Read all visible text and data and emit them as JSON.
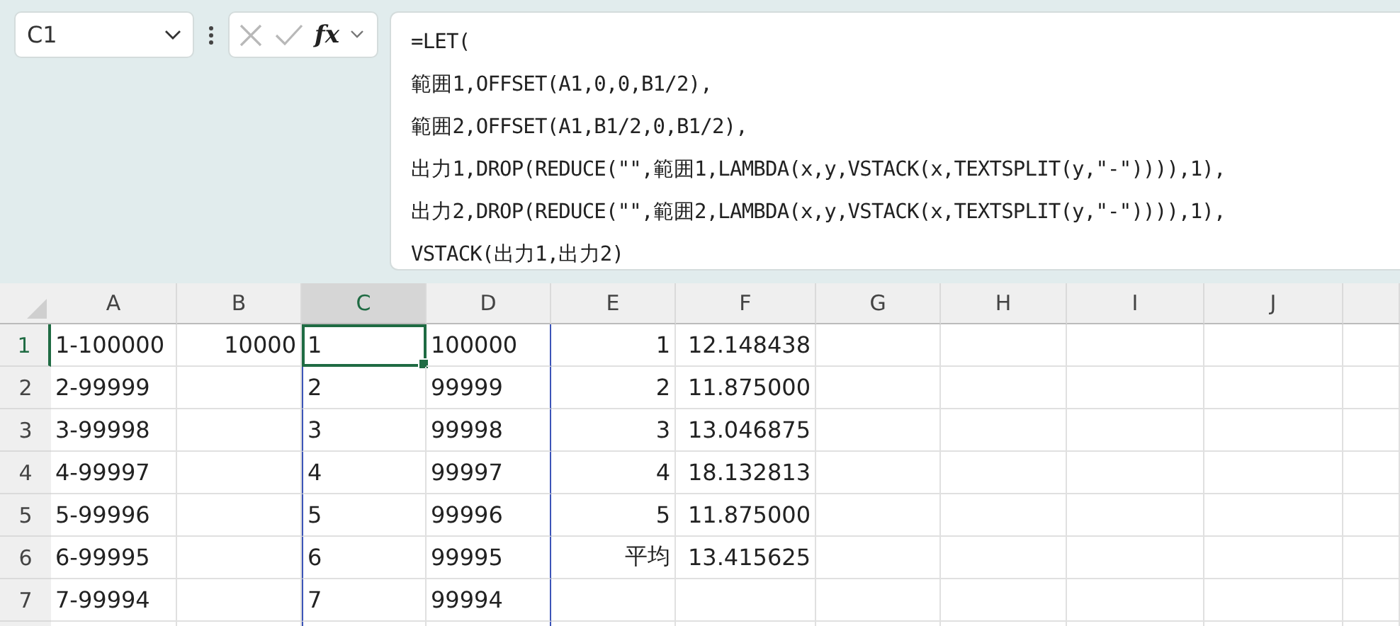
{
  "name_box": {
    "value": "C1"
  },
  "formula_buttons": {
    "disabled": true,
    "function_label": "fx"
  },
  "formula_bar": {
    "lines": [
      "=LET(",
      "範囲1,OFFSET(A1,0,0,B1/2),",
      "範囲2,OFFSET(A1,B1/2,0,B1/2),",
      "出力1,DROP(REDUCE(\"\",範囲1,LAMBDA(x,y,VSTACK(x,TEXTSPLIT(y,\"-\")))),1),",
      "出力2,DROP(REDUCE(\"\",範囲2,LAMBDA(x,y,VSTACK(x,TEXTSPLIT(y,\"-\")))),1),",
      "VSTACK(出力1,出力2)"
    ]
  },
  "sheet": {
    "columns": [
      {
        "letter": "A",
        "selected": false,
        "in_spill": false
      },
      {
        "letter": "B",
        "selected": false,
        "in_spill": false
      },
      {
        "letter": "C",
        "selected": true,
        "in_spill": true
      },
      {
        "letter": "D",
        "selected": false,
        "in_spill": true
      },
      {
        "letter": "E",
        "selected": false,
        "in_spill": false
      },
      {
        "letter": "F",
        "selected": false,
        "in_spill": false
      },
      {
        "letter": "G",
        "selected": false,
        "in_spill": false
      },
      {
        "letter": "H",
        "selected": false,
        "in_spill": false
      },
      {
        "letter": "I",
        "selected": false,
        "in_spill": false
      },
      {
        "letter": "J",
        "selected": false,
        "in_spill": false
      }
    ],
    "rows": [
      {
        "number": "1",
        "selected": true,
        "cells": [
          {
            "text": "1-100000",
            "kind": "text"
          },
          {
            "text": "10000",
            "kind": "number"
          },
          {
            "text": "1",
            "kind": "text"
          },
          {
            "text": "100000",
            "kind": "text"
          },
          {
            "text": "1",
            "kind": "number"
          },
          {
            "text": "12.148438",
            "kind": "number"
          },
          null,
          null,
          null,
          null
        ]
      },
      {
        "number": "2",
        "selected": false,
        "cells": [
          {
            "text": "2-99999",
            "kind": "text"
          },
          null,
          {
            "text": "2",
            "kind": "text"
          },
          {
            "text": "99999",
            "kind": "text"
          },
          {
            "text": "2",
            "kind": "number"
          },
          {
            "text": "11.875000",
            "kind": "number"
          },
          null,
          null,
          null,
          null
        ]
      },
      {
        "number": "3",
        "selected": false,
        "cells": [
          {
            "text": "3-99998",
            "kind": "text"
          },
          null,
          {
            "text": "3",
            "kind": "text"
          },
          {
            "text": "99998",
            "kind": "text"
          },
          {
            "text": "3",
            "kind": "number"
          },
          {
            "text": "13.046875",
            "kind": "number"
          },
          null,
          null,
          null,
          null
        ]
      },
      {
        "number": "4",
        "selected": false,
        "cells": [
          {
            "text": "4-99997",
            "kind": "text"
          },
          null,
          {
            "text": "4",
            "kind": "text"
          },
          {
            "text": "99997",
            "kind": "text"
          },
          {
            "text": "4",
            "kind": "number"
          },
          {
            "text": "18.132813",
            "kind": "number"
          },
          null,
          null,
          null,
          null
        ]
      },
      {
        "number": "5",
        "selected": false,
        "cells": [
          {
            "text": "5-99996",
            "kind": "text"
          },
          null,
          {
            "text": "5",
            "kind": "text"
          },
          {
            "text": "99996",
            "kind": "text"
          },
          {
            "text": "5",
            "kind": "number"
          },
          {
            "text": "11.875000",
            "kind": "number"
          },
          null,
          null,
          null,
          null
        ]
      },
      {
        "number": "6",
        "selected": false,
        "cells": [
          {
            "text": "6-99995",
            "kind": "text"
          },
          null,
          {
            "text": "6",
            "kind": "text"
          },
          {
            "text": "99995",
            "kind": "text"
          },
          {
            "text": "平均",
            "kind": "number"
          },
          {
            "text": "13.415625",
            "kind": "number"
          },
          null,
          null,
          null,
          null
        ]
      },
      {
        "number": "7",
        "selected": false,
        "cells": [
          {
            "text": "7-99994",
            "kind": "text"
          },
          null,
          {
            "text": "7",
            "kind": "text"
          },
          {
            "text": "99994",
            "kind": "text"
          },
          null,
          null,
          null,
          null,
          null,
          null
        ]
      }
    ]
  }
}
